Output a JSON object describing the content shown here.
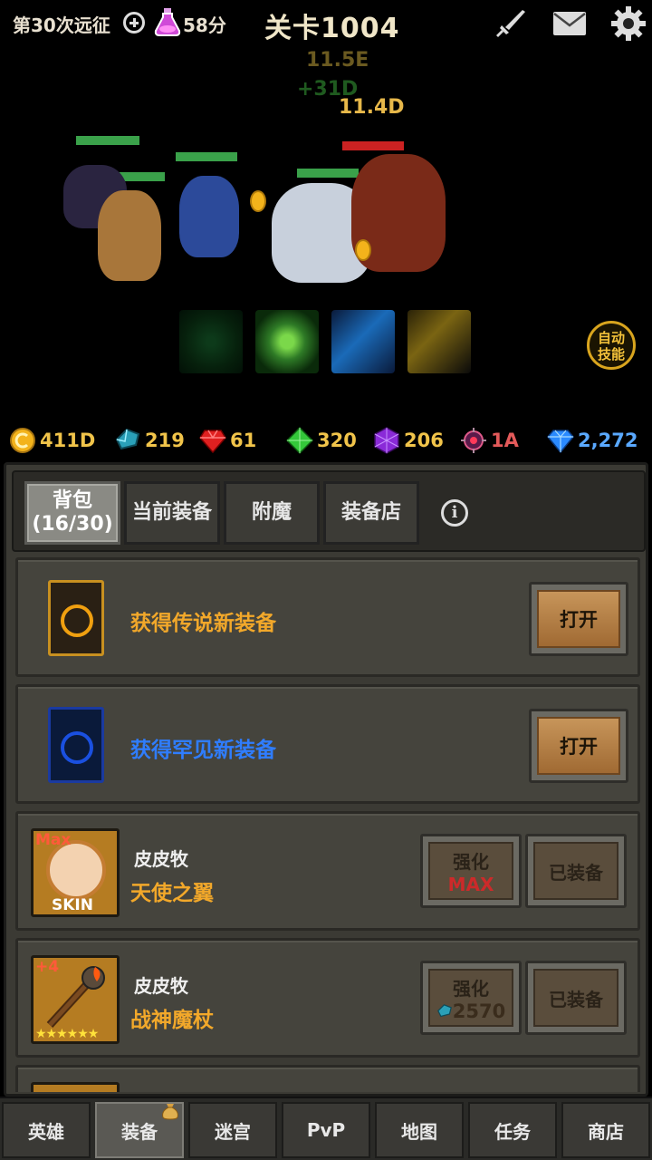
{
  "topbar": {
    "expedition": "第30次远征",
    "potion_time": "58分",
    "stage": "关卡1004"
  },
  "battle": {
    "damage_numbers": [
      "11.5E",
      "+31D",
      "11.4D"
    ],
    "auto_skill": [
      "自动",
      "技能"
    ]
  },
  "currencies": [
    {
      "icon": "gold-coin-icon",
      "value": "411D",
      "color": "#f1c44a"
    },
    {
      "icon": "blue-crystal-icon",
      "value": "219",
      "color": "#f1c44a"
    },
    {
      "icon": "red-gem-icon",
      "value": "61",
      "color": "#f1c44a"
    },
    {
      "icon": "green-gem-icon",
      "value": "320",
      "color": "#f1c44a"
    },
    {
      "icon": "purple-gem-icon",
      "value": "206",
      "color": "#f1c44a"
    },
    {
      "icon": "dark-orb-icon",
      "value": "1A",
      "color": "#e35a5a"
    },
    {
      "icon": "diamond-icon",
      "value": "2,272",
      "color": "#5aa9ff"
    }
  ],
  "tabs": [
    {
      "line1": "背包",
      "line2": "(16/30)",
      "active": true
    },
    {
      "line1": "当前装备",
      "line2": "",
      "active": false
    },
    {
      "line1": "附魔",
      "line2": "",
      "active": false
    },
    {
      "line1": "装备店",
      "line2": "",
      "active": false
    }
  ],
  "items": {
    "legendary": {
      "title": "获得传说新装备",
      "button": "打开",
      "color": "#f2a82a"
    },
    "rare": {
      "title": "获得罕见新装备",
      "button": "打开",
      "color": "#2f7dff"
    },
    "equip1": {
      "badge": "Max",
      "skin": "SKIN",
      "owner": "皮皮牧",
      "name": "天使之翼",
      "upgrade_label": "强化",
      "upgrade_value": "MAX",
      "equipped": "已装备"
    },
    "equip2": {
      "badge": "+4",
      "owner": "皮皮牧",
      "name": "战神魔杖",
      "upgrade_label": "强化",
      "upgrade_value": "2570",
      "equipped": "已装备",
      "stars": "★★★★★★"
    }
  },
  "nav": [
    {
      "label": "英雄",
      "active": false
    },
    {
      "label": "装备",
      "active": true
    },
    {
      "label": "迷宫",
      "active": false
    },
    {
      "label": "PvP",
      "active": false
    },
    {
      "label": "地图",
      "active": false
    },
    {
      "label": "任务",
      "active": false
    },
    {
      "label": "商店",
      "active": false
    }
  ]
}
